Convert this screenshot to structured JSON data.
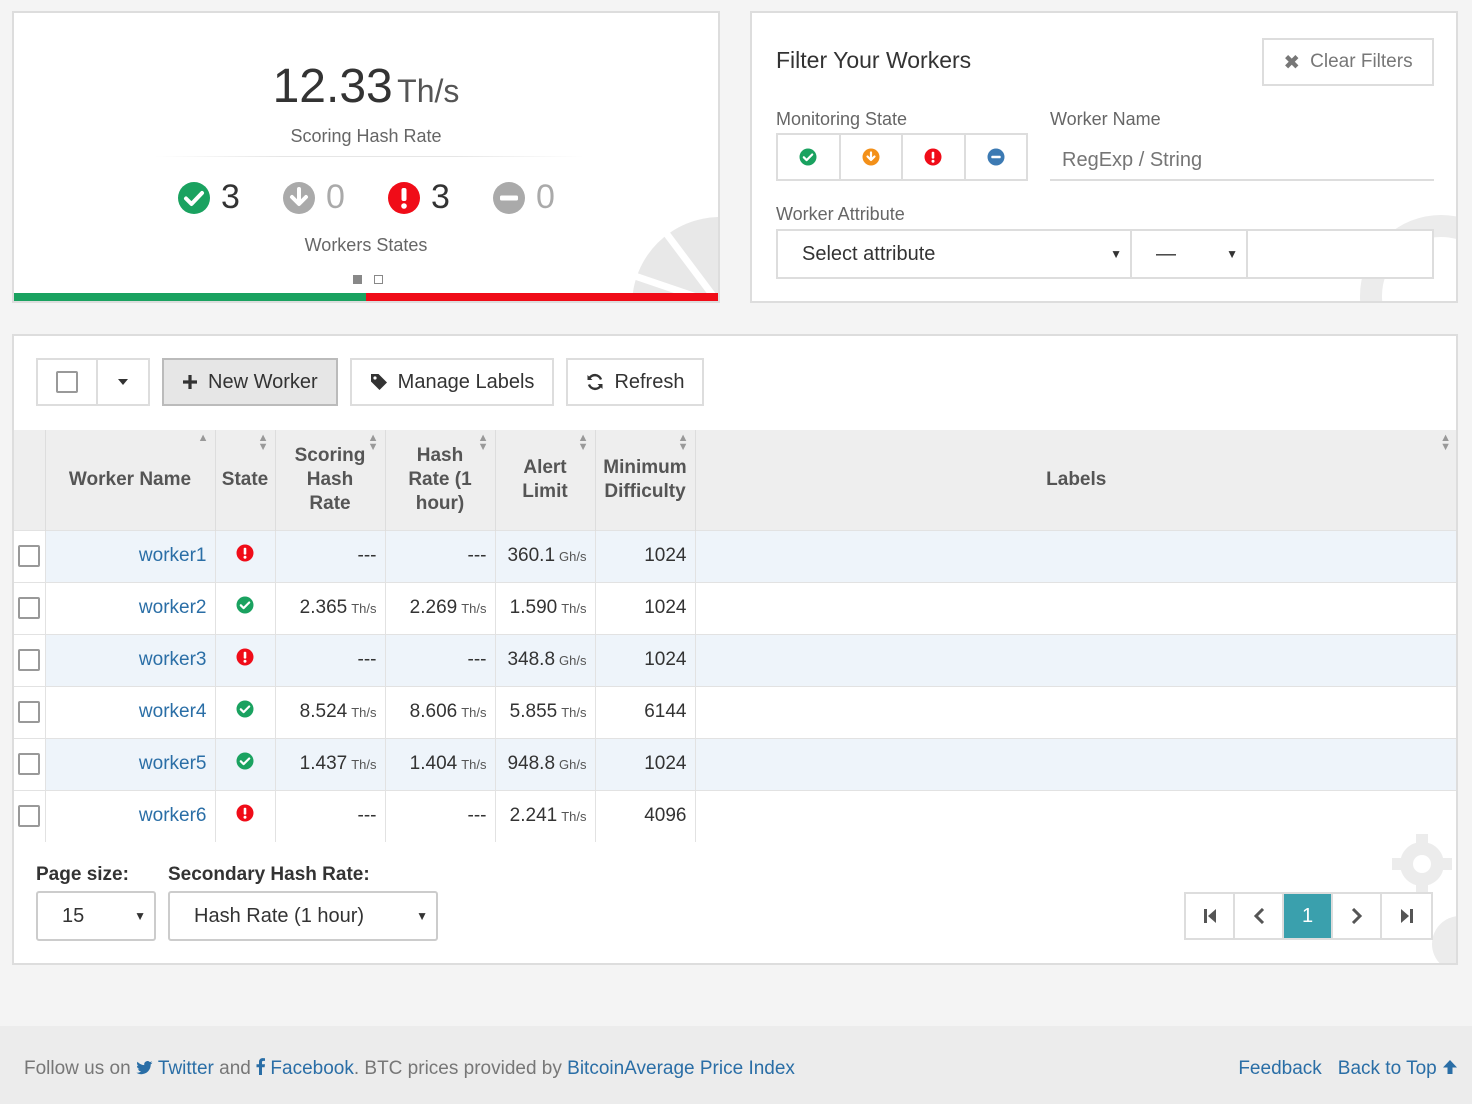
{
  "summary": {
    "hash_rate_value": "12.33",
    "hash_rate_unit": "Th/s",
    "hash_rate_label": "Scoring Hash Rate",
    "states_label": "Workers States",
    "states": [
      {
        "icon": "check-circle-icon",
        "count": "3",
        "color": "#1aa260"
      },
      {
        "icon": "arrow-down-circle-icon",
        "count": "0",
        "color": "#aaaaaa"
      },
      {
        "icon": "exclamation-circle-icon",
        "count": "3",
        "color": "#f00c18"
      },
      {
        "icon": "minus-circle-icon",
        "count": "0",
        "color": "#aaaaaa"
      }
    ],
    "ok_fraction": 0.5,
    "colors": {
      "ok": "#1aa260",
      "alert": "#f00c18"
    }
  },
  "filter": {
    "title": "Filter Your Workers",
    "clear_label": "Clear Filters",
    "monitoring_state_label": "Monitoring State",
    "monitoring_states": [
      "ok-icon",
      "low-icon",
      "off-icon",
      "disabled-icon"
    ],
    "worker_name_label": "Worker Name",
    "worker_name_placeholder": "RegExp / String",
    "worker_attribute_label": "Worker Attribute",
    "attribute_select": "Select attribute",
    "operator_select": "—"
  },
  "toolbar": {
    "new_worker": "New Worker",
    "manage_labels": "Manage Labels",
    "refresh": "Refresh"
  },
  "table": {
    "headers": {
      "worker_name": "Worker Name",
      "state": "State",
      "scoring_hash_rate": "Scoring Hash Rate",
      "hash_rate_1h": "Hash Rate (1 hour)",
      "alert_limit": "Alert Limit",
      "minimum_difficulty": "Minimum Difficulty",
      "labels": "Labels"
    },
    "rows": [
      {
        "name": "worker1",
        "state": "alert",
        "scoring": "---",
        "scoring_unit": "",
        "hr1h": "---",
        "hr1h_unit": "",
        "alert": "360.1",
        "alert_unit": "Gh/s",
        "difficulty": "1024"
      },
      {
        "name": "worker2",
        "state": "ok",
        "scoring": "2.365",
        "scoring_unit": "Th/s",
        "hr1h": "2.269",
        "hr1h_unit": "Th/s",
        "alert": "1.590",
        "alert_unit": "Th/s",
        "difficulty": "1024"
      },
      {
        "name": "worker3",
        "state": "alert",
        "scoring": "---",
        "scoring_unit": "",
        "hr1h": "---",
        "hr1h_unit": "",
        "alert": "348.8",
        "alert_unit": "Gh/s",
        "difficulty": "1024"
      },
      {
        "name": "worker4",
        "state": "ok",
        "scoring": "8.524",
        "scoring_unit": "Th/s",
        "hr1h": "8.606",
        "hr1h_unit": "Th/s",
        "alert": "5.855",
        "alert_unit": "Th/s",
        "difficulty": "6144"
      },
      {
        "name": "worker5",
        "state": "ok",
        "scoring": "1.437",
        "scoring_unit": "Th/s",
        "hr1h": "1.404",
        "hr1h_unit": "Th/s",
        "alert": "948.8",
        "alert_unit": "Gh/s",
        "difficulty": "1024"
      },
      {
        "name": "worker6",
        "state": "alert",
        "scoring": "---",
        "scoring_unit": "",
        "hr1h": "---",
        "hr1h_unit": "",
        "alert": "2.241",
        "alert_unit": "Th/s",
        "difficulty": "4096"
      }
    ]
  },
  "paging": {
    "page_size_label": "Page size:",
    "page_size": "15",
    "secondary_label": "Secondary Hash Rate:",
    "secondary_value": "Hash Rate (1 hour)",
    "current_page": "1"
  },
  "footer": {
    "follow": "Follow us on",
    "twitter": "Twitter",
    "and": "and",
    "facebook": "Facebook",
    "btc_text": ". BTC prices provided by",
    "price_index": "BitcoinAverage Price Index",
    "feedback": "Feedback",
    "back_to_top": "Back to Top"
  }
}
